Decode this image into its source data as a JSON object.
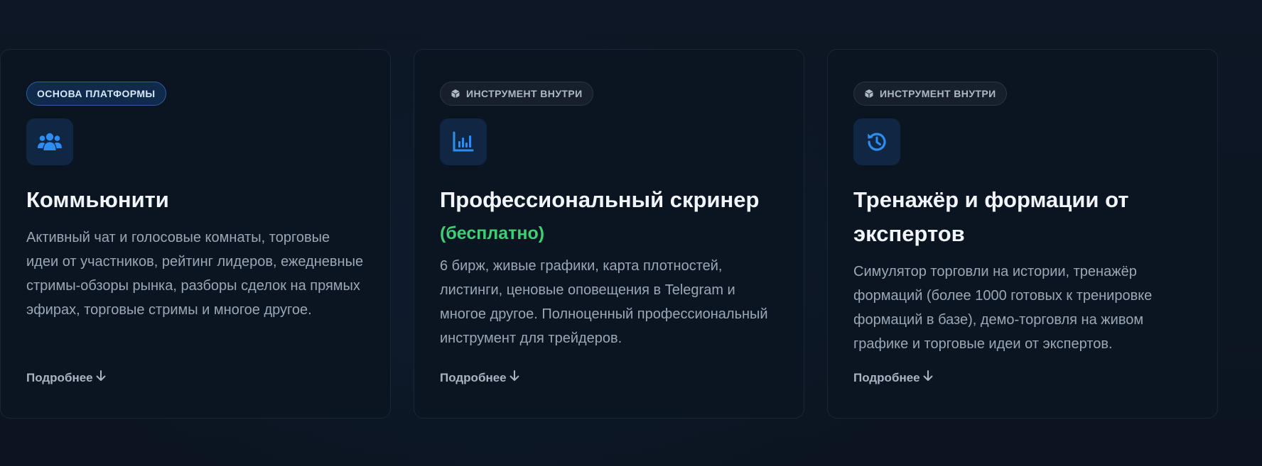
{
  "cards": [
    {
      "badge": "ОСНОВА ПЛАТФОРМЫ",
      "icon": "users-icon",
      "title": "Коммьюнити",
      "subtitle": "",
      "description": "Активный чат и голосовые комнаты, торговые идеи от участников, рейтинг лидеров, ежедневные стримы-обзоры рынка, разборы сделок на прямых эфирах, торговые стримы и многое другое.",
      "link": "Подробнее"
    },
    {
      "badge": "ИНСТРУМЕНТ ВНУТРИ",
      "icon": "chart-bars-icon",
      "title": "Профессиональный скринер",
      "subtitle": "(бесплатно)",
      "description": "6 бирж, живые графики, карта плотностей, листинги, ценовые оповещения в Telegram и многое другое. Полноценный профессиональный инструмент для трейдеров.",
      "link": "Подробнее"
    },
    {
      "badge": "ИНСТРУМЕНТ ВНУТРИ",
      "icon": "history-icon",
      "title": "Тренажёр и формации от экспертов",
      "subtitle": "",
      "description": "Симулятор торговли на истории, тренажёр формаций (более 1000 готовых к тренировке формаций в базе), демо-торговля на живом графике и торговые идеи от экспертов.",
      "link": "Подробнее"
    }
  ],
  "colors": {
    "background": "#0c1522",
    "card": "#0b1421",
    "accent_blue": "#2f8cf0",
    "accent_green": "#3ccf73",
    "text_muted": "#9ba6b6"
  }
}
